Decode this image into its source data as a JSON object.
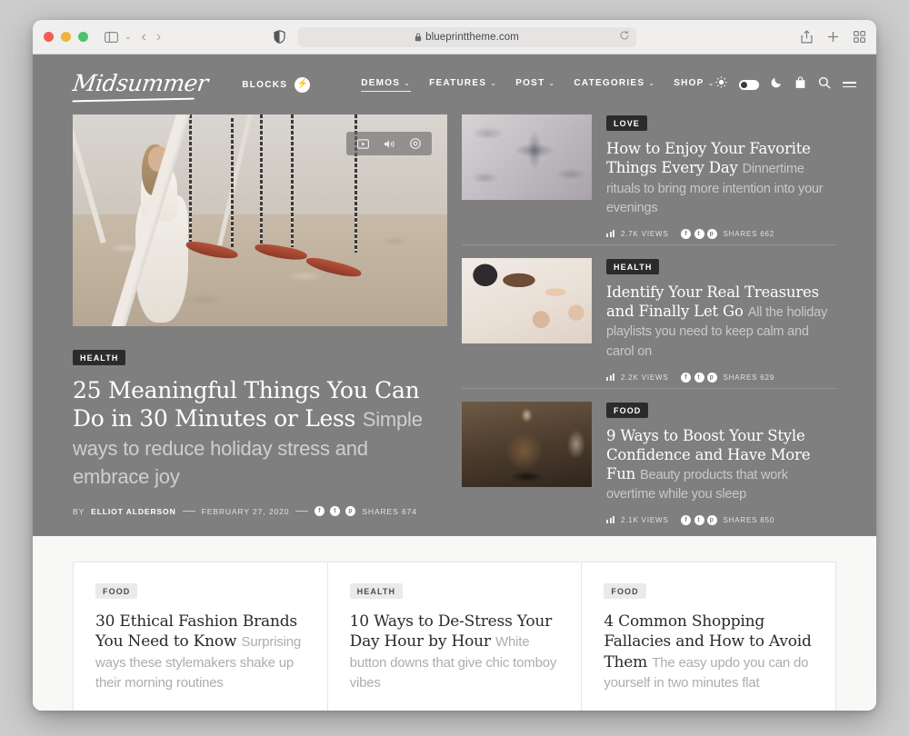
{
  "browser": {
    "url": "blueprinttheme.com",
    "icons": {
      "sidebar": "sidebar-icon",
      "back": "‹",
      "forward": "›",
      "shield": "privacy-shield-icon",
      "lock": "lock-icon",
      "reload": "reload-icon",
      "share": "share-icon",
      "new_tab": "+",
      "tabs": "tab-overview-icon"
    }
  },
  "site": {
    "logo": "Midsummer",
    "blocks_label": "BLOCKS",
    "bolt": "⚡",
    "nav": [
      {
        "label": "DEMOS",
        "chevron": "⌄",
        "active": true
      },
      {
        "label": "FEATURES",
        "chevron": "⌄",
        "active": false
      },
      {
        "label": "POST",
        "chevron": "⌄",
        "active": false
      },
      {
        "label": "CATEGORIES",
        "chevron": "⌄",
        "active": false
      },
      {
        "label": "SHOP",
        "chevron": "⌄",
        "active": false
      }
    ],
    "tools": {
      "sun": "sun-icon",
      "moon": "moon-icon",
      "bag": "shopping-bag-icon",
      "search": "search-icon",
      "menu": "hamburger-icon"
    }
  },
  "hero": {
    "media_controls": {
      "play": "video-play-icon",
      "volume": "volume-icon",
      "settings": "settings-icon"
    },
    "badge": "HEALTH",
    "title": "25 Meaningful Things You Can Do in 30 Minutes or Less",
    "excerpt": "Simple ways to reduce holiday stress and embrace joy",
    "meta": {
      "by_label": "BY",
      "author": "ELLIOT ALDERSON",
      "date": "FEBRUARY 27, 2020",
      "shares": "SHARES 674",
      "socials": [
        "f",
        "t",
        "p"
      ]
    }
  },
  "side_posts": [
    {
      "badge": "LOVE",
      "title": "How to Enjoy Your Favorite Things Every Day",
      "excerpt": "Dinnertime rituals to bring more intention into your evenings",
      "views": "2.7K VIEWS",
      "shares": "SHARES 662",
      "socials": [
        "f",
        "t",
        "p"
      ]
    },
    {
      "badge": "HEALTH",
      "title": "Identify Your Real Treasures and Finally Let Go",
      "excerpt": "All the holiday playlists you need to keep calm and carol on",
      "views": "2.2K VIEWS",
      "shares": "SHARES 629",
      "socials": [
        "f",
        "t",
        "p"
      ]
    },
    {
      "badge": "FOOD",
      "title": "9 Ways to Boost Your Style Confidence and Have More Fun",
      "excerpt": "Beauty products that work overtime while you sleep",
      "views": "2.1K VIEWS",
      "shares": "SHARES 850",
      "socials": [
        "f",
        "t",
        "p"
      ]
    }
  ],
  "cards": [
    {
      "badge": "FOOD",
      "title": "30 Ethical Fashion Brands You Need to Know",
      "excerpt": "Surprising ways these stylemakers shake up their morning routines"
    },
    {
      "badge": "HEALTH",
      "title": "10 Ways to De-Stress Your Day Hour by Hour",
      "excerpt": "White button downs that give chic tomboy vibes"
    },
    {
      "badge": "FOOD",
      "title": "4 Common Shopping Fallacies and How to Avoid Them",
      "excerpt": "The easy updo you can do yourself in two minutes flat"
    }
  ],
  "colors": {
    "hero_bg": "#7f7f7f",
    "page_bg": "#f8f8f7",
    "badge_dark": "#2b2b2b",
    "badge_light": "#eceae8"
  }
}
